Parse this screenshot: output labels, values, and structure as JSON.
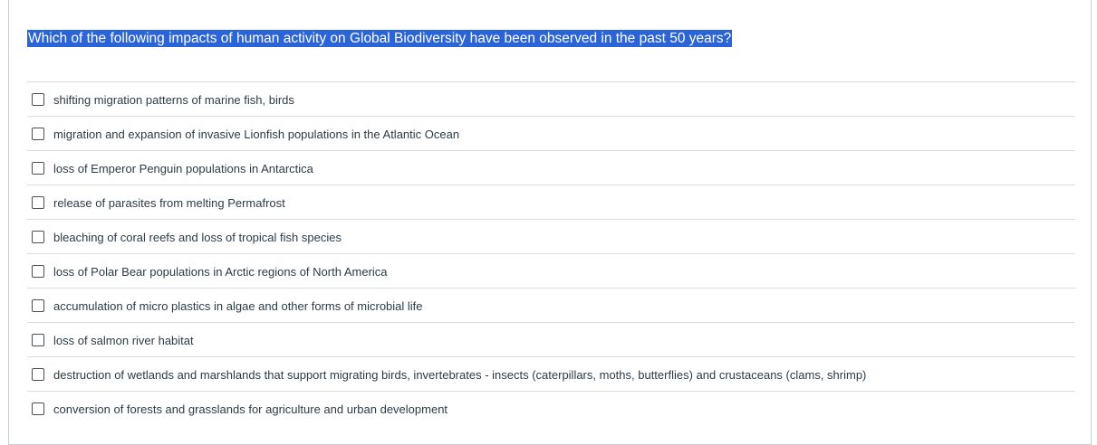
{
  "question": {
    "text": "Which of the following impacts of human activity on Global Biodiversity have been observed in the past 50 years?"
  },
  "answers": [
    {
      "label": "shifting migration patterns of marine fish, birds",
      "checked": false
    },
    {
      "label": "migration and expansion of invasive Lionfish populations in the Atlantic Ocean",
      "checked": false
    },
    {
      "label": "loss of Emperor Penguin populations in Antarctica",
      "checked": false
    },
    {
      "label": "release of parasites from melting Permafrost",
      "checked": false
    },
    {
      "label": "bleaching of coral reefs and loss of tropical fish species",
      "checked": false
    },
    {
      "label": "loss of Polar Bear populations in Arctic regions of North America",
      "checked": false
    },
    {
      "label": "accumulation of micro plastics in algae and other forms of microbial life",
      "checked": false
    },
    {
      "label": "loss of salmon river habitat",
      "checked": false
    },
    {
      "label": "destruction of wetlands and marshlands that support migrating birds, invertebrates - insects (caterpillars, moths, butterflies) and crustaceans (clams, shrimp)",
      "checked": false
    },
    {
      "label": "conversion of forests and grasslands for agriculture and urban development",
      "checked": false
    }
  ],
  "colors": {
    "selection_highlight": "#2a64d8",
    "text": "#2d3b45",
    "divider": "#d8dde0"
  }
}
